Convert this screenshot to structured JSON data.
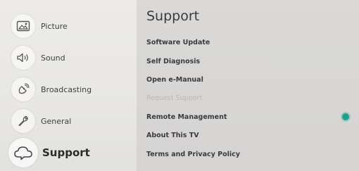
{
  "nav": {
    "items": [
      {
        "label": "Picture",
        "icon": "picture-icon"
      },
      {
        "label": "Sound",
        "icon": "speaker-icon"
      },
      {
        "label": "Broadcasting",
        "icon": "satellite-icon"
      },
      {
        "label": "General",
        "icon": "wrench-icon"
      },
      {
        "label": "Support",
        "icon": "support-cloud-icon"
      }
    ],
    "selected": "Support"
  },
  "support": {
    "title": "Support",
    "items": [
      {
        "label": "Software Update"
      },
      {
        "label": "Self Diagnosis"
      },
      {
        "label": "Open e-Manual"
      },
      {
        "label": "Request Support"
      },
      {
        "label": "Remote Management"
      },
      {
        "label": "About This TV"
      },
      {
        "label": "Terms and Privacy Policy"
      }
    ],
    "remote_management_status_color": "#1aa38a"
  },
  "colors": {
    "accent": "#1aa38a",
    "disabled_text": "#b9b8b6"
  }
}
